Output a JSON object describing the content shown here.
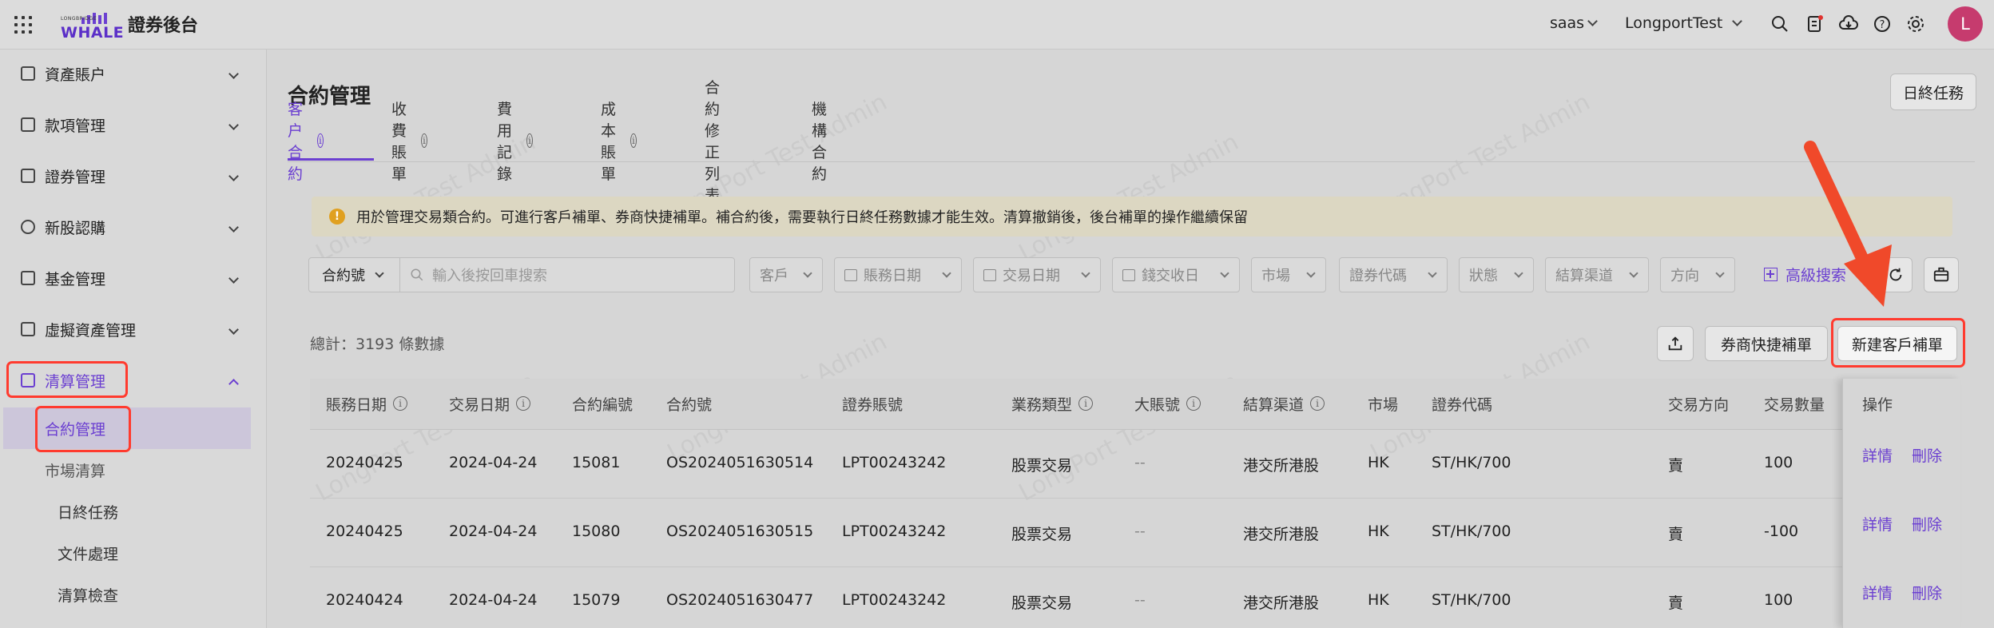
{
  "topbar": {
    "logo_sub": "LONGBRIDGE",
    "logo_word": "WHALE",
    "app_title": "證券後台",
    "env_select": "saas",
    "org_select": "LongportTest",
    "avatar_letter": "L",
    "icons": [
      "apps-grid-icon",
      "search-icon",
      "task-list-icon",
      "download-icon",
      "help-icon",
      "settings-icon"
    ]
  },
  "sidebar": {
    "items": [
      {
        "label": "資產賬户",
        "icon": "wallet-icon"
      },
      {
        "label": "款項管理",
        "icon": "document-icon"
      },
      {
        "label": "證券管理",
        "icon": "chart-box-icon"
      },
      {
        "label": "新股認購",
        "icon": "percent-icon"
      },
      {
        "label": "基金管理",
        "icon": "trend-icon"
      },
      {
        "label": "虛擬資產管理",
        "icon": "virtual-asset-icon"
      },
      {
        "label": "清算管理",
        "icon": "clearing-icon"
      }
    ],
    "sub_items": [
      "合約管理",
      "市場清算"
    ],
    "sub_sub_items": [
      "日終任務",
      "文件處理",
      "清算檢查"
    ]
  },
  "page": {
    "title": "合約管理",
    "eod_button": "日終任務",
    "tabs": [
      "客户合約",
      "收費賬單",
      "費用記錄",
      "成本賬單",
      "合約修正列表",
      "機構合約"
    ],
    "notice": "用於管理交易類合約。可進行客戶補單、券商快捷補單。補合約後，需要執行日終任務數據才能生效。清算撤銷後，後台補單的操作繼續保留",
    "watermark": "LongPort Test Admin"
  },
  "filters": {
    "search_type": "合約號",
    "search_placeholder": "輸入後按回車搜索",
    "dropdowns": [
      "客戶",
      "賬務日期",
      "交易日期",
      "錢交收日",
      "市場",
      "證券代碼",
      "狀態",
      "結算渠道",
      "方向"
    ],
    "advanced": "高級搜索"
  },
  "actions": {
    "total": "總計：3193 條數據",
    "broker_quick": "券商快捷補單",
    "new_client": "新建客戶補單"
  },
  "table": {
    "columns": [
      "賬務日期",
      "交易日期",
      "合約編號",
      "合約號",
      "證券賬號",
      "業務類型",
      "大賬號",
      "結算渠道",
      "市場",
      "證券代碼",
      "交易方向",
      "交易數量",
      "操作"
    ],
    "rows": [
      [
        "20240425",
        "2024-04-24",
        "15081",
        "OS2024051630514",
        "LPT00243242",
        "股票交易",
        "--",
        "港交所港股",
        "HK",
        "ST/HK/700",
        "賣",
        "100"
      ],
      [
        "20240425",
        "2024-04-24",
        "15080",
        "OS2024051630515",
        "LPT00243242",
        "股票交易",
        "--",
        "港交所港股",
        "HK",
        "ST/HK/700",
        "賣",
        "-100"
      ],
      [
        "20240424",
        "2024-04-24",
        "15079",
        "OS2024051630477",
        "LPT00243242",
        "股票交易",
        "--",
        "港交所港股",
        "HK",
        "ST/HK/700",
        "賣",
        "100"
      ]
    ],
    "op_detail": "詳情",
    "op_delete": "刪除"
  },
  "colors": {
    "accent": "#6b3fd1",
    "highlight": "#ff3b2f"
  }
}
